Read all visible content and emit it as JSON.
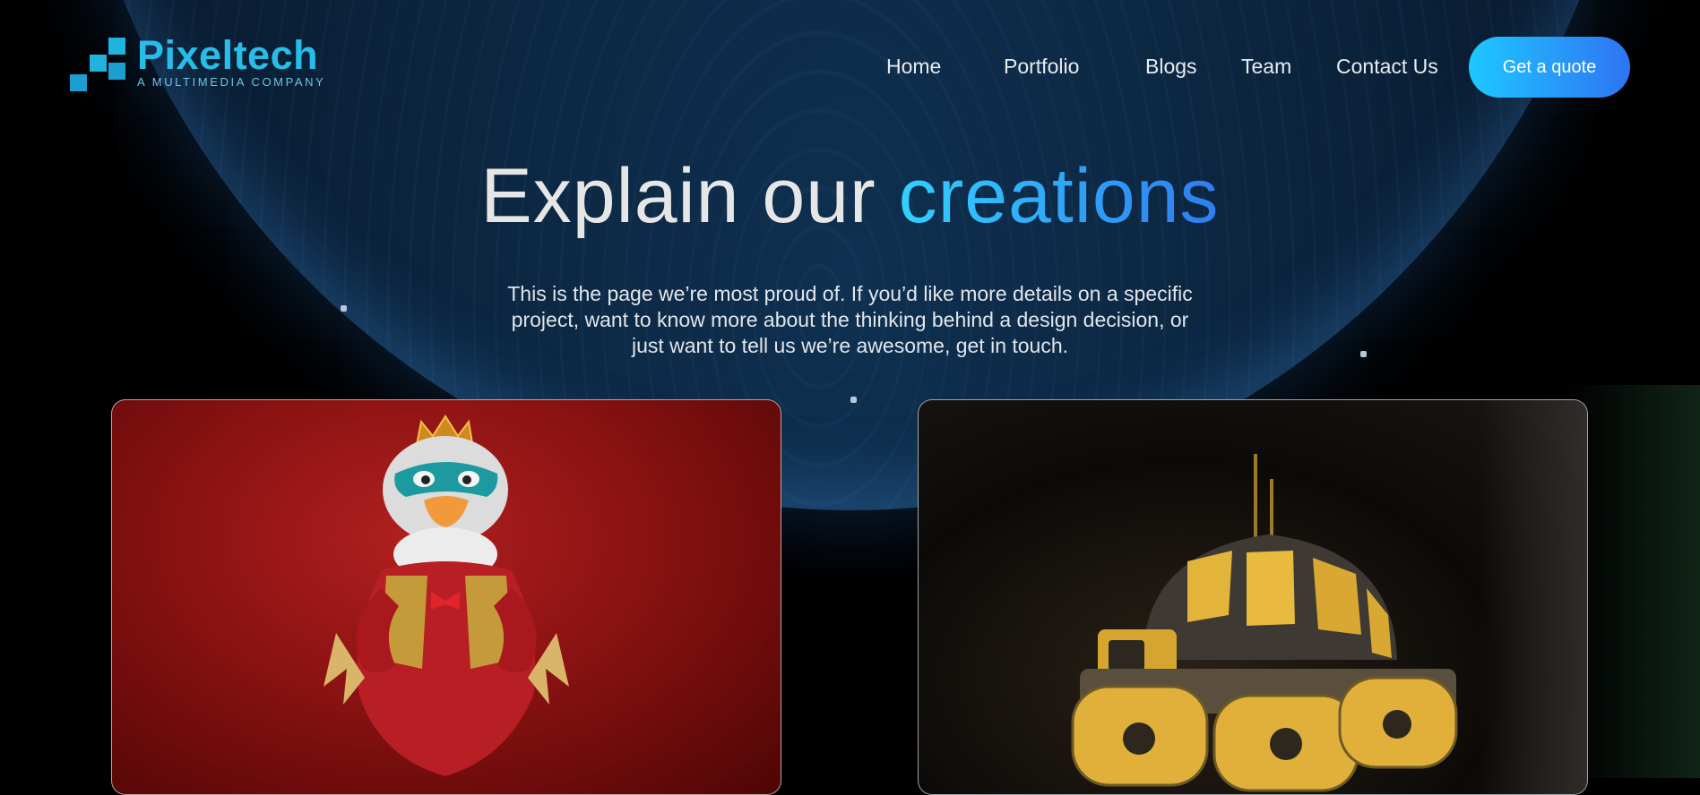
{
  "brand": {
    "name": "Pixeltech",
    "tagline": "A MULTIMEDIA COMPANY",
    "color": "#27bde8"
  },
  "nav": {
    "items": [
      {
        "label": "Home"
      },
      {
        "label": "Portfolio"
      },
      {
        "label": "Blogs"
      },
      {
        "label": "Team"
      },
      {
        "label": "Contact Us"
      }
    ],
    "cta_label": "Get a quote",
    "cta_gradient": [
      "#1ec8ff",
      "#2f74f4"
    ]
  },
  "hero": {
    "title_plain": "Explain our",
    "title_accent": "creations",
    "description": "This is the page we’re most proud of. If you’d like more details on a specific project, want to know more about the thinking behind a design decision, or just want to tell us we’re awesome, get in touch."
  },
  "portfolio": {
    "cards": [
      {
        "icon": "penguin-character-image",
        "background": "#8a1212"
      },
      {
        "icon": "yellow-tank-robot-image",
        "background": "#0c0a08"
      }
    ]
  }
}
